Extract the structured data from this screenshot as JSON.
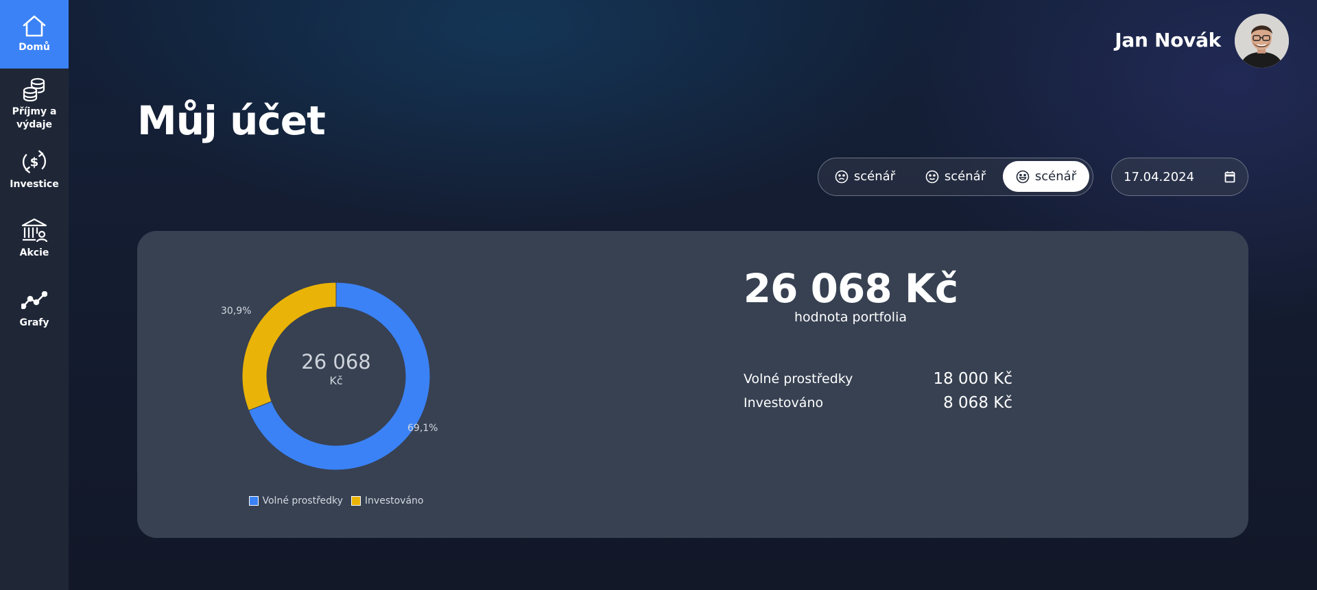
{
  "sidebar": {
    "items": [
      {
        "label": "Domů",
        "icon": "home-icon",
        "active": true
      },
      {
        "label": "Příjmy a výdaje",
        "icon": "coins-icon",
        "active": false
      },
      {
        "label": "Investice",
        "icon": "dollar-cycle-icon",
        "active": false
      },
      {
        "label": "Akcie",
        "icon": "bank-icon",
        "active": false
      },
      {
        "label": "Grafy",
        "icon": "line-chart-icon",
        "active": false
      }
    ]
  },
  "header": {
    "user_name": "Jan Novák"
  },
  "page": {
    "title": "Můj účet"
  },
  "scenarios": {
    "items": [
      {
        "label": "scénář",
        "icon": "sad-face-icon",
        "selected": false
      },
      {
        "label": "scénář",
        "icon": "neutral-face-icon",
        "selected": false
      },
      {
        "label": "scénář",
        "icon": "happy-face-icon",
        "selected": true
      }
    ]
  },
  "date": {
    "value": "17.04.2024",
    "icon": "calendar-icon"
  },
  "portfolio": {
    "total": "26 068 Kč",
    "caption": "hodnota portfolia",
    "rows": [
      {
        "label": "Volné prostředky",
        "value": "18 000 Kč"
      },
      {
        "label": "Investováno",
        "value": "8 068 Kč"
      }
    ]
  },
  "chart_data": {
    "type": "pie",
    "center_value": "26 068",
    "center_unit": "Kč",
    "slices": [
      {
        "name": "Volné prostředky",
        "value": 18000,
        "label": "69,1%",
        "color": "#3b82f6"
      },
      {
        "name": "Investováno",
        "value": 8068,
        "label": "30,9%",
        "color": "#eab308"
      }
    ],
    "legend_position": "bottom"
  },
  "colors": {
    "accent": "#3b82f6",
    "secondary": "#eab308",
    "card": "#374152",
    "sidebar": "#1f2737"
  }
}
